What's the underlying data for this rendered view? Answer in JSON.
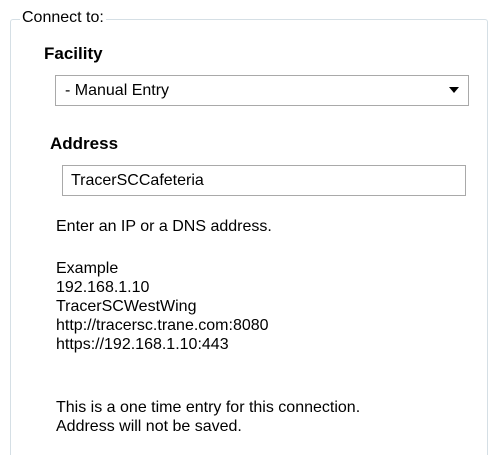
{
  "group": {
    "legend": "Connect to:"
  },
  "facility": {
    "label": "Facility",
    "selected": "- Manual Entry",
    "arrow_icon": "dropdown-arrow-icon"
  },
  "address": {
    "label": "Address",
    "value": "TracerSCCafeteria"
  },
  "hint": "Enter an IP or a DNS address.",
  "example": {
    "heading": "Example",
    "lines": [
      "192.168.1.10",
      "TracerSCWestWing",
      "http://tracersc.trane.com:8080",
      "https://192.168.1.10:443"
    ]
  },
  "note": {
    "line1": "This is a one time entry for this connection.",
    "line2": "Address will not be saved."
  },
  "colors": {
    "group_border": "#d5dfe5",
    "field_border": "#a9a9a9",
    "text": "#000000",
    "background": "#ffffff"
  }
}
